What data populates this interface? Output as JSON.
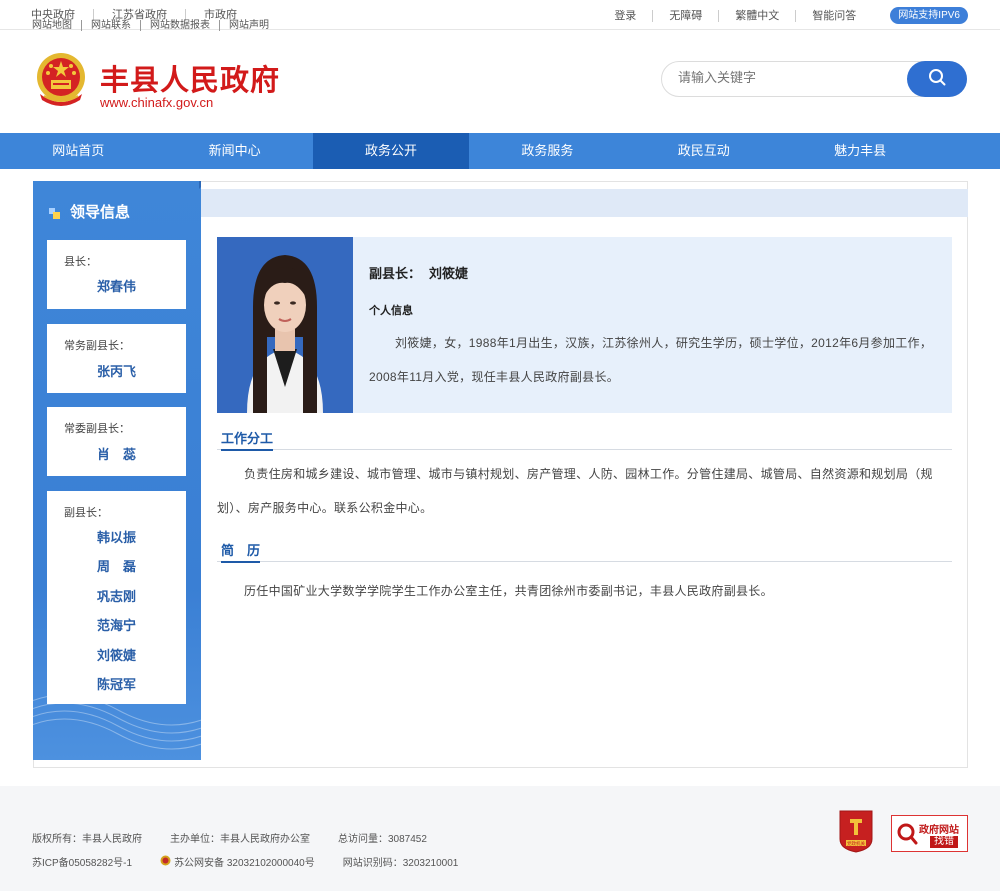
{
  "topbar": {
    "left_links": [
      "中央政府",
      "江苏省政府",
      "市政府"
    ],
    "right_links": [
      "登录",
      "无障碍",
      "繁體中文",
      "智能问答"
    ],
    "ipv6_badge": "网站支持IPV6"
  },
  "header": {
    "title": "丰县人民政府",
    "url": "www.chinafx.gov.cn",
    "search_placeholder": "请输入关键字"
  },
  "nav": {
    "items": [
      "网站首页",
      "新闻中心",
      "政务公开",
      "政务服务",
      "政民互动",
      "魅力丰县"
    ],
    "active": "政务公开"
  },
  "sidebar": {
    "title": "领导信息",
    "groups": [
      {
        "role": "县长：",
        "names": [
          "郑春伟"
        ]
      },
      {
        "role": "常务副县长：",
        "names": [
          "张丙飞"
        ]
      },
      {
        "role": "常委副县长：",
        "names": [
          "肖　蕊"
        ]
      },
      {
        "role": "副县长：",
        "names": [
          "韩以振",
          "周　磊",
          "巩志刚",
          "范海宁",
          "刘筱婕",
          "陈冠军"
        ]
      }
    ]
  },
  "profile": {
    "position": "副县长：",
    "name": "刘筱婕",
    "info_heading": "个人信息",
    "bio": "刘筱婕，女，1988年1月出生，汉族，江苏徐州人，研究生学历，硕士学位，2012年6月参加工作，2008年11月入党，现任丰县人民政府副县长。"
  },
  "sections": {
    "duty_heading": "工作分工",
    "duty_text": "负责住房和城乡建设、城市管理、城市与镇村规划、房产管理、人防、园林工作。分管住建局、城管局、自然资源和规划局（规划）、房产服务中心。联系公积金中心。",
    "resume_heading": "简　历",
    "resume_text": "历任中国矿业大学数学学院学生工作办公室主任，共青团徐州市委副书记，丰县人民政府副县长。"
  },
  "footer": {
    "links": [
      "网站地图",
      "网站联系",
      "网站数据报表",
      "网站声明"
    ],
    "copyright": "版权所有：丰县人民政府",
    "sponsor": "主办单位：丰县人民政府办公室",
    "visits": "总访问量：3087452",
    "icp": "苏ICP备05058282号-1",
    "police": "苏公网安备 32032102000040号",
    "site_id": "网站识别码：3203210001",
    "badge1_label": "党政机关",
    "badge2_line1": "政府网站",
    "badge2_line2": "找错"
  },
  "colors": {
    "nav_blue": "#3d85d9",
    "nav_active": "#1b5db3",
    "title_red": "#d21a1a",
    "link_blue": "#2a5fa8"
  }
}
